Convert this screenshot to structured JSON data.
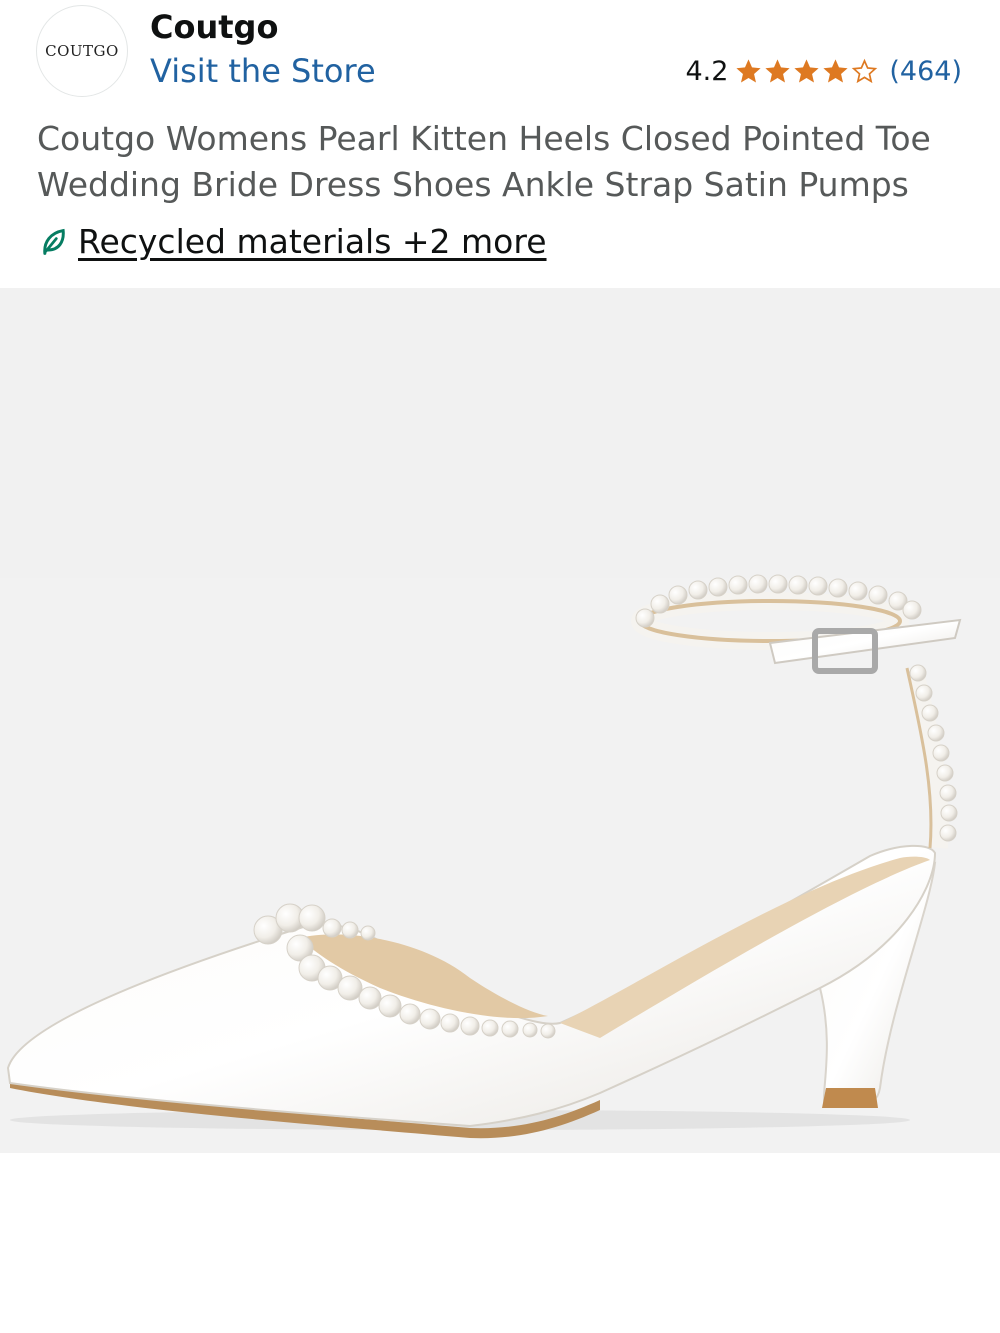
{
  "brand": {
    "logo_text": "COUTGO",
    "name": "Coutgo",
    "visit_store": "Visit the Store"
  },
  "rating": {
    "value": "4.2",
    "stars_filled": 4,
    "stars_total": 5,
    "review_count": "(464)",
    "star_color": "#de7921"
  },
  "product": {
    "title": "Coutgo Womens Pearl Kitten Heels Closed Pointed Toe Wedding Bride Dress Shoes Ankle Strap Satin Pumps"
  },
  "features": {
    "icon": "leaf-icon",
    "link_text": "Recycled materials +2 more",
    "icon_color": "#067d62"
  },
  "image": {
    "subject": "shoe-image"
  },
  "colors": {
    "link": "#2162a1",
    "text": "#0f1111",
    "muted": "#565959"
  }
}
